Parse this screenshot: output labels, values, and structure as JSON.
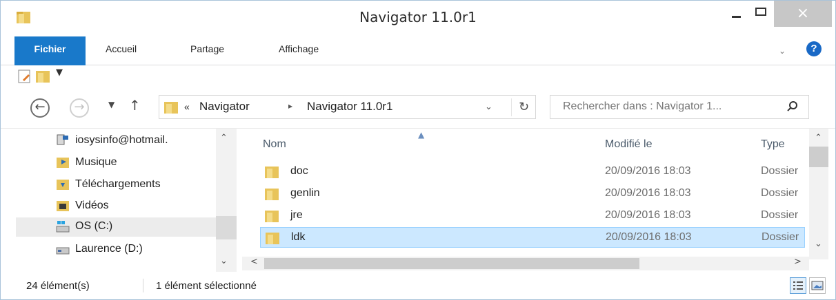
{
  "window": {
    "title": "Navigator 11.0r1",
    "close_glyph": "×"
  },
  "ribbon": {
    "tabs": [
      {
        "label": "Fichier",
        "active": true
      },
      {
        "label": "Accueil"
      },
      {
        "label": "Partage"
      },
      {
        "label": "Affichage"
      }
    ],
    "help_glyph": "?"
  },
  "address_bar": {
    "breadcrumb_prefix": "«",
    "crumbs": [
      "Navigator",
      "Navigator 11.0r1"
    ],
    "separator": "▸"
  },
  "search": {
    "placeholder": "Rechercher dans : Navigator 1..."
  },
  "nav_pane": {
    "items": [
      {
        "label": "iosysinfo@hotmail.",
        "icon": "network-user-icon"
      },
      {
        "label": "Musique",
        "icon": "music-folder-icon"
      },
      {
        "label": "Téléchargements",
        "icon": "downloads-folder-icon"
      },
      {
        "label": "Vidéos",
        "icon": "videos-folder-icon"
      },
      {
        "label": "OS (C:)",
        "icon": "windows-drive-icon",
        "selected": true
      },
      {
        "label": "Laurence (D:)",
        "icon": "drive-icon"
      }
    ]
  },
  "file_list": {
    "columns": [
      "Nom",
      "Modifié le",
      "Type"
    ],
    "rows": [
      {
        "name": "doc",
        "modified": "20/09/2016 18:03",
        "type": "Dossier"
      },
      {
        "name": "genlin",
        "modified": "20/09/2016 18:03",
        "type": "Dossier"
      },
      {
        "name": "jre",
        "modified": "20/09/2016 18:03",
        "type": "Dossier"
      },
      {
        "name": "ldk",
        "modified": "20/09/2016 18:03",
        "type": "Dossier",
        "selected": true
      }
    ]
  },
  "status_bar": {
    "item_count": "24 élément(s)",
    "selection": "1 élément sélectionné"
  },
  "colors": {
    "accent": "#1979ca",
    "selection_bg": "#cce8ff",
    "folder": "#e8c45a"
  }
}
